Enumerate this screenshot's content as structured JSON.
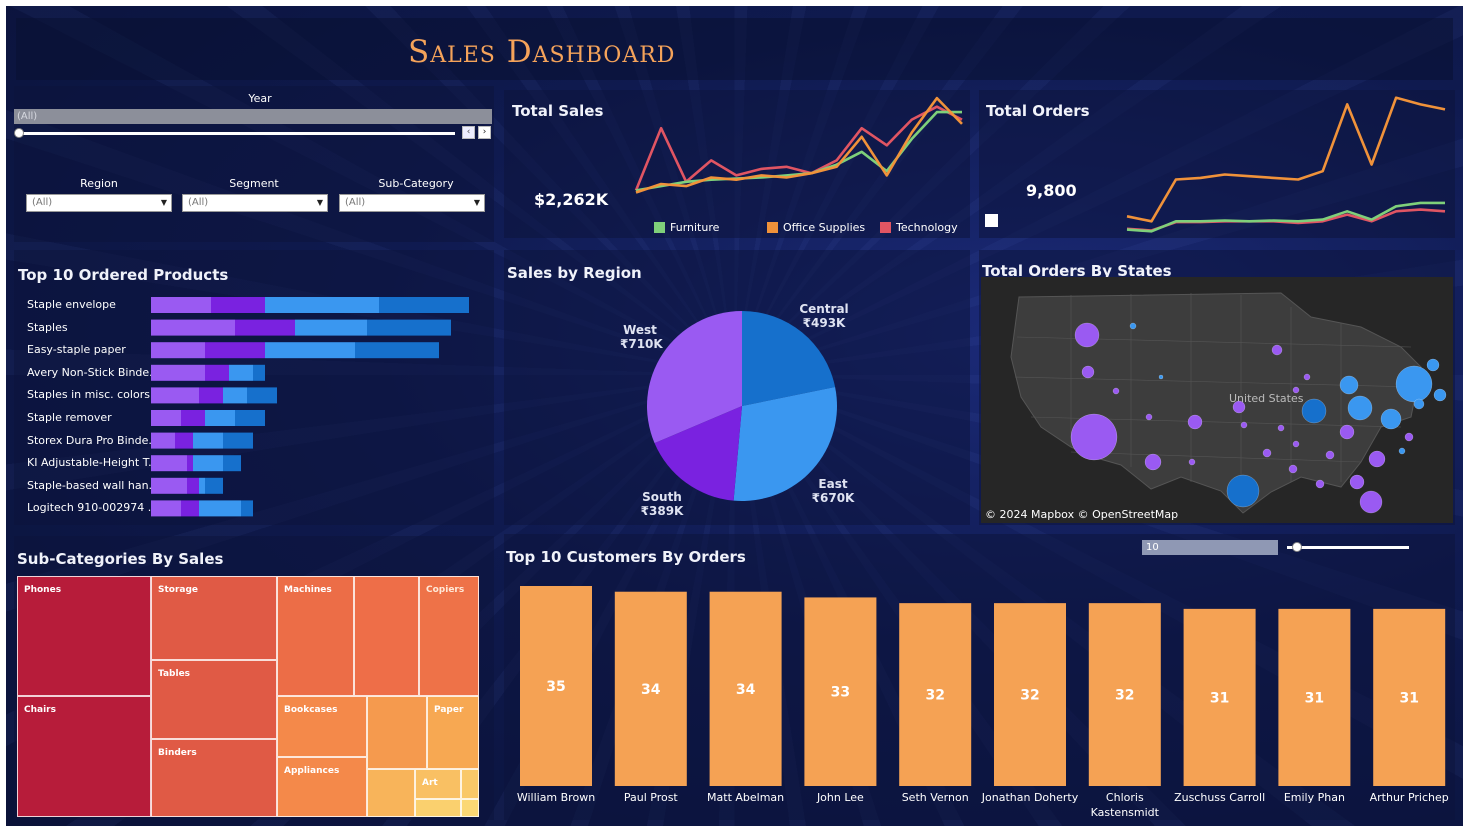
{
  "title": "Sales Dashboard",
  "filters": {
    "year_label": "Year",
    "year_value": "(All)",
    "region_label": "Region",
    "region_value": "(All)",
    "segment_label": "Segment",
    "segment_value": "(All)",
    "subcat_label": "Sub-Category",
    "subcat_value": "(All)"
  },
  "total_sales": {
    "title": "Total Sales",
    "value": "$2,262K"
  },
  "total_orders": {
    "title": "Total Orders",
    "value": "9,800"
  },
  "legend": [
    "Furniture",
    "Office Supplies",
    "Technology"
  ],
  "colors": {
    "furniture": "#7fd07a",
    "office": "#f0923a",
    "technology": "#e05563",
    "purple_light": "#9a5af2",
    "purple_dark": "#7a22e0",
    "blue_light": "#3a97f0",
    "blue_dark": "#1670cc",
    "bar_orange": "#f5a254",
    "title_orange": "#f5a35a"
  },
  "top_products": {
    "title": "Top 10 Ordered Products",
    "items": [
      "Staple envelope",
      "Staples",
      "Easy-staple paper",
      "Avery Non-Stick Binde..",
      "Staples in misc. colors",
      "Staple remover",
      "Storex Dura Pro Binde..",
      "KI Adjustable-Height T..",
      "Staple-based wall han..",
      "Logitech 910-002974 .."
    ]
  },
  "sales_region": {
    "title": "Sales by Region",
    "labels": {
      "west_name": "West",
      "west_value": "₹710K",
      "central_name": "Central",
      "central_value": "₹493K",
      "east_name": "East",
      "east_value": "₹670K",
      "south_name": "South",
      "south_value": "₹389K"
    }
  },
  "orders_states": {
    "title": "Total Orders By States",
    "map_label": "United States",
    "credit": "© 2024 Mapbox  © OpenStreetMap"
  },
  "subcategories": {
    "title": "Sub-Categories By Sales",
    "cells": {
      "phones": "Phones",
      "chairs": "Chairs",
      "storage": "Storage",
      "tables": "Tables",
      "binders": "Binders",
      "machines": "Machines",
      "copiers": "Copiers",
      "bookcases": "Bookcases",
      "paper": "Paper",
      "appliances": "Appliances",
      "art": "Art"
    }
  },
  "top_customers": {
    "title": "Top 10 Customers By Orders",
    "slider_value": "10",
    "names": [
      "William Brown",
      "Paul Prost",
      "Matt Abelman",
      "John Lee",
      "Seth Vernon",
      "Jonathan Doherty",
      "Chloris Kastensmidt",
      "Zuschuss Carroll",
      "Emily Phan",
      "Arthur Prichep"
    ],
    "values": [
      35,
      34,
      34,
      33,
      32,
      32,
      32,
      31,
      31,
      31
    ]
  },
  "chart_data": [
    {
      "type": "line",
      "title": "Total Sales",
      "x": [
        1,
        2,
        3,
        4,
        5,
        6,
        7,
        8,
        9,
        10,
        11,
        12,
        13,
        14
      ],
      "series": [
        {
          "name": "Furniture",
          "values": [
            22,
            26,
            30,
            32,
            33,
            34,
            36,
            38,
            46,
            58,
            40,
            70,
            95,
            95
          ]
        },
        {
          "name": "Office Supplies",
          "values": [
            20,
            28,
            26,
            34,
            32,
            36,
            34,
            38,
            44,
            72,
            36,
            76,
            108,
            84
          ]
        },
        {
          "name": "Technology",
          "values": [
            22,
            80,
            30,
            50,
            36,
            42,
            44,
            38,
            50,
            80,
            64,
            88,
            100,
            88
          ]
        }
      ]
    },
    {
      "type": "line",
      "title": "Total Orders",
      "x": [
        1,
        2,
        3,
        4,
        5,
        6,
        7,
        8,
        9,
        10,
        11,
        12,
        13,
        14
      ],
      "series": [
        {
          "name": "Furniture",
          "values": [
            10,
            8,
            20,
            20,
            21,
            20,
            21,
            20,
            22,
            32,
            22,
            38,
            42,
            42
          ]
        },
        {
          "name": "Office Supplies",
          "values": [
            26,
            20,
            70,
            72,
            76,
            74,
            72,
            70,
            80,
            160,
            88,
            168,
            160,
            154
          ]
        },
        {
          "name": "Technology",
          "values": [
            11,
            9,
            19,
            19,
            20,
            20,
            20,
            18,
            20,
            28,
            20,
            32,
            34,
            32
          ]
        }
      ]
    },
    {
      "type": "bar",
      "title": "Top 10 Ordered Products",
      "categories": [
        "Staple envelope",
        "Staples",
        "Easy-staple paper",
        "Avery Non-Stick Binde..",
        "Staples in misc. colors",
        "Staple remover",
        "Storex Dura Pro Binde..",
        "KI Adjustable-Height T..",
        "Staple-based wall han..",
        "Logitech 910-002974 .."
      ],
      "series": [
        {
          "values": [
            10,
            14,
            9,
            9,
            8,
            5,
            4,
            6,
            6,
            5
          ]
        },
        {
          "values": [
            9,
            10,
            10,
            4,
            4,
            4,
            3,
            1,
            2,
            3
          ]
        },
        {
          "values": [
            19,
            12,
            15,
            4,
            4,
            5,
            5,
            5,
            1,
            7
          ]
        },
        {
          "values": [
            15,
            14,
            14,
            2,
            5,
            5,
            5,
            3,
            3,
            2
          ]
        }
      ]
    },
    {
      "type": "pie",
      "title": "Sales by Region",
      "categories": [
        "Central",
        "East",
        "South",
        "West"
      ],
      "values": [
        493,
        670,
        389,
        710
      ]
    },
    {
      "type": "bar",
      "title": "Top 10 Customers By Orders",
      "categories": [
        "William Brown",
        "Paul Prost",
        "Matt Abelman",
        "John Lee",
        "Seth Vernon",
        "Jonathan Doherty",
        "Chloris Kastensmidt",
        "Zuschuss Carroll",
        "Emily Phan",
        "Arthur Prichep"
      ],
      "values": [
        35,
        34,
        34,
        33,
        32,
        32,
        32,
        31,
        31,
        31
      ],
      "ylim": [
        0,
        35
      ]
    }
  ]
}
